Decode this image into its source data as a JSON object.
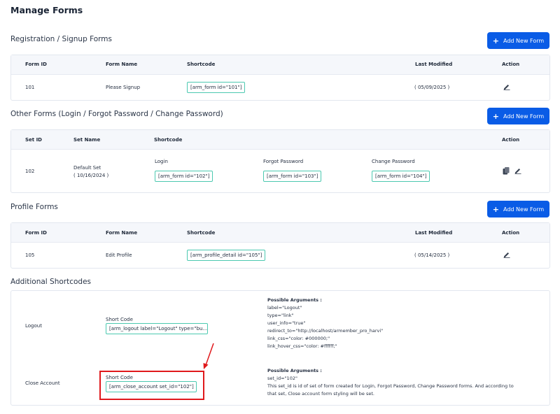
{
  "page": {
    "title": "Manage Forms"
  },
  "add_button_label": "Add New Form",
  "registration": {
    "title": "Registration / Signup Forms",
    "headers": {
      "id": "Form ID",
      "name": "Form Name",
      "shortcode": "Shortcode",
      "modified": "Last Modified",
      "action": "Action"
    },
    "rows": [
      {
        "id": "101",
        "name": "Please Signup",
        "shortcode": "[arm_form id=\"101\"]",
        "modified": "( 05/09/2025 )"
      }
    ]
  },
  "other": {
    "title": "Other Forms (Login / Forgot Password / Change Password)",
    "headers": {
      "id": "Set ID",
      "name": "Set Name",
      "shortcode": "Shortcode",
      "action": "Action"
    },
    "rows": [
      {
        "id": "102",
        "name": "Default Set",
        "date": "( 10/16/2024 )",
        "login_label": "Login",
        "login_sc": "[arm_form id=\"102\"]",
        "forgot_label": "Forgot Password",
        "forgot_sc": "[arm_form id=\"103\"]",
        "change_label": "Change Password",
        "change_sc": "[arm_form id=\"104\"]"
      }
    ]
  },
  "profile": {
    "title": "Profile Forms",
    "headers": {
      "id": "Form ID",
      "name": "Form Name",
      "shortcode": "Shortcode",
      "modified": "Last Modified",
      "action": "Action"
    },
    "rows": [
      {
        "id": "105",
        "name": "Edit Profile",
        "shortcode": "[arm_profile_detail id=\"105\"]",
        "modified": "( 05/14/2025 )"
      }
    ]
  },
  "additional": {
    "title": "Additional Shortcodes",
    "rows": [
      {
        "name": "Logout",
        "short_code_label": "Short Code",
        "shortcode": "[arm_logout label=\"Logout\" type=\"bu...",
        "args_title": "Possible Arguments :",
        "args": [
          "label=\"Logout\"",
          "type=\"link\"",
          "user_info=\"true\"",
          "redirect_to=\"http://localhost/armember_pro_harvi\"",
          "link_css=\"color: #000000;\"",
          "link_hover_css=\"color: #ffffff;\""
        ]
      },
      {
        "name": "Close Account",
        "short_code_label": "Short Code",
        "shortcode": "[arm_close_account set_id=\"102\"]",
        "args_title": "Possible Arguments :",
        "args": [
          "set_id=\"102\"",
          "This set_id is id of set of form created for Login, Forgot Password, Change Password forms. And according to",
          "that set, Close account form styling will be set."
        ]
      }
    ]
  },
  "colors": {
    "primary": "#0a5ce6",
    "shortcode_border": "#4cc9b0",
    "highlight": "#e0191c"
  }
}
